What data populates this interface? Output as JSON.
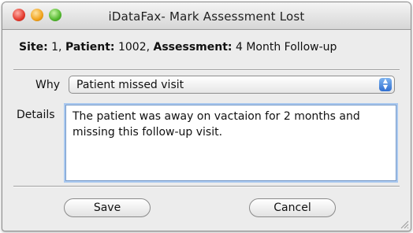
{
  "window": {
    "title": "iDataFax- Mark Assessment Lost"
  },
  "info": {
    "site_label": "Site:",
    "site_value": "1,",
    "patient_label": "Patient:",
    "patient_value": "1002,",
    "assessment_label": "Assessment:",
    "assessment_value": "4 Month Follow-up"
  },
  "form": {
    "why_label": "Why",
    "why_value": "Patient missed visit",
    "details_label": "Details",
    "details_value": "The patient was away on vactaion for 2 months and missing this follow-up visit."
  },
  "buttons": {
    "save_label": "Save",
    "cancel_label": "Cancel"
  },
  "icons": {
    "close": "close-icon",
    "minimize": "minimize-icon",
    "zoom": "zoom-icon",
    "select_arrows": "updown-arrows-icon",
    "resize": "resize-grip-icon"
  },
  "colors": {
    "close": "#e33a2e",
    "minimize": "#f0a21c",
    "zoom": "#52b72e",
    "select_accent": "#2f6fd1",
    "focus_ring": "#a9c8ef"
  }
}
